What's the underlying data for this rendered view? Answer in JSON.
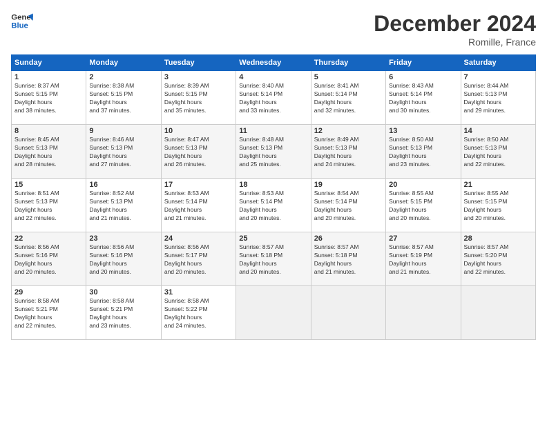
{
  "header": {
    "logo_line1": "General",
    "logo_line2": "Blue",
    "title": "December 2024",
    "location": "Romille, France"
  },
  "days_of_week": [
    "Sunday",
    "Monday",
    "Tuesday",
    "Wednesday",
    "Thursday",
    "Friday",
    "Saturday"
  ],
  "rows": [
    [
      {
        "day": "1",
        "sunrise": "8:37 AM",
        "sunset": "5:15 PM",
        "daylight": "8 hours and 38 minutes."
      },
      {
        "day": "2",
        "sunrise": "8:38 AM",
        "sunset": "5:15 PM",
        "daylight": "8 hours and 37 minutes."
      },
      {
        "day": "3",
        "sunrise": "8:39 AM",
        "sunset": "5:15 PM",
        "daylight": "8 hours and 35 minutes."
      },
      {
        "day": "4",
        "sunrise": "8:40 AM",
        "sunset": "5:14 PM",
        "daylight": "8 hours and 33 minutes."
      },
      {
        "day": "5",
        "sunrise": "8:41 AM",
        "sunset": "5:14 PM",
        "daylight": "8 hours and 32 minutes."
      },
      {
        "day": "6",
        "sunrise": "8:43 AM",
        "sunset": "5:14 PM",
        "daylight": "8 hours and 30 minutes."
      },
      {
        "day": "7",
        "sunrise": "8:44 AM",
        "sunset": "5:13 PM",
        "daylight": "8 hours and 29 minutes."
      }
    ],
    [
      {
        "day": "8",
        "sunrise": "8:45 AM",
        "sunset": "5:13 PM",
        "daylight": "8 hours and 28 minutes."
      },
      {
        "day": "9",
        "sunrise": "8:46 AM",
        "sunset": "5:13 PM",
        "daylight": "8 hours and 27 minutes."
      },
      {
        "day": "10",
        "sunrise": "8:47 AM",
        "sunset": "5:13 PM",
        "daylight": "8 hours and 26 minutes."
      },
      {
        "day": "11",
        "sunrise": "8:48 AM",
        "sunset": "5:13 PM",
        "daylight": "8 hours and 25 minutes."
      },
      {
        "day": "12",
        "sunrise": "8:49 AM",
        "sunset": "5:13 PM",
        "daylight": "8 hours and 24 minutes."
      },
      {
        "day": "13",
        "sunrise": "8:50 AM",
        "sunset": "5:13 PM",
        "daylight": "8 hours and 23 minutes."
      },
      {
        "day": "14",
        "sunrise": "8:50 AM",
        "sunset": "5:13 PM",
        "daylight": "8 hours and 22 minutes."
      }
    ],
    [
      {
        "day": "15",
        "sunrise": "8:51 AM",
        "sunset": "5:13 PM",
        "daylight": "8 hours and 22 minutes."
      },
      {
        "day": "16",
        "sunrise": "8:52 AM",
        "sunset": "5:13 PM",
        "daylight": "8 hours and 21 minutes."
      },
      {
        "day": "17",
        "sunrise": "8:53 AM",
        "sunset": "5:14 PM",
        "daylight": "8 hours and 21 minutes."
      },
      {
        "day": "18",
        "sunrise": "8:53 AM",
        "sunset": "5:14 PM",
        "daylight": "8 hours and 20 minutes."
      },
      {
        "day": "19",
        "sunrise": "8:54 AM",
        "sunset": "5:14 PM",
        "daylight": "8 hours and 20 minutes."
      },
      {
        "day": "20",
        "sunrise": "8:55 AM",
        "sunset": "5:15 PM",
        "daylight": "8 hours and 20 minutes."
      },
      {
        "day": "21",
        "sunrise": "8:55 AM",
        "sunset": "5:15 PM",
        "daylight": "8 hours and 20 minutes."
      }
    ],
    [
      {
        "day": "22",
        "sunrise": "8:56 AM",
        "sunset": "5:16 PM",
        "daylight": "8 hours and 20 minutes."
      },
      {
        "day": "23",
        "sunrise": "8:56 AM",
        "sunset": "5:16 PM",
        "daylight": "8 hours and 20 minutes."
      },
      {
        "day": "24",
        "sunrise": "8:56 AM",
        "sunset": "5:17 PM",
        "daylight": "8 hours and 20 minutes."
      },
      {
        "day": "25",
        "sunrise": "8:57 AM",
        "sunset": "5:18 PM",
        "daylight": "8 hours and 20 minutes."
      },
      {
        "day": "26",
        "sunrise": "8:57 AM",
        "sunset": "5:18 PM",
        "daylight": "8 hours and 21 minutes."
      },
      {
        "day": "27",
        "sunrise": "8:57 AM",
        "sunset": "5:19 PM",
        "daylight": "8 hours and 21 minutes."
      },
      {
        "day": "28",
        "sunrise": "8:57 AM",
        "sunset": "5:20 PM",
        "daylight": "8 hours and 22 minutes."
      }
    ],
    [
      {
        "day": "29",
        "sunrise": "8:58 AM",
        "sunset": "5:21 PM",
        "daylight": "8 hours and 22 minutes."
      },
      {
        "day": "30",
        "sunrise": "8:58 AM",
        "sunset": "5:21 PM",
        "daylight": "8 hours and 23 minutes."
      },
      {
        "day": "31",
        "sunrise": "8:58 AM",
        "sunset": "5:22 PM",
        "daylight": "8 hours and 24 minutes."
      },
      null,
      null,
      null,
      null
    ]
  ]
}
